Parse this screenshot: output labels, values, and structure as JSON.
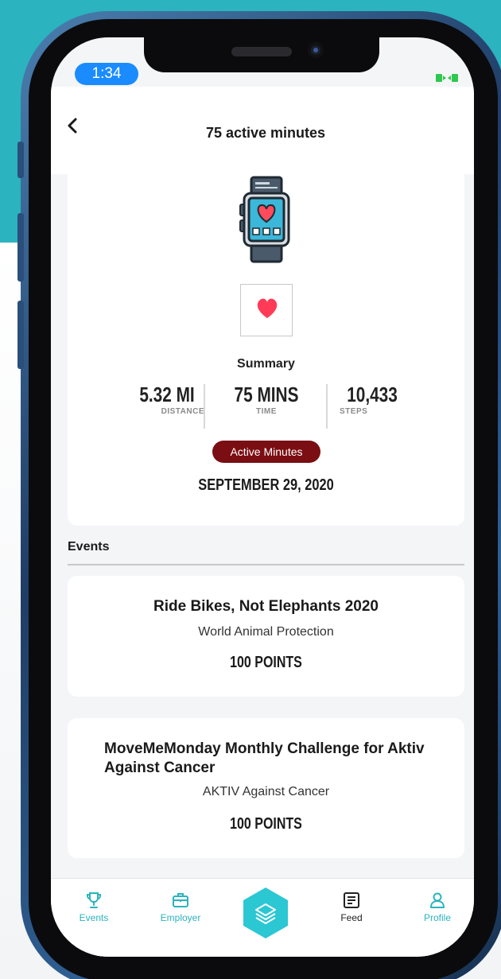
{
  "status": {
    "time": "1:34"
  },
  "header": {
    "title": "75 active minutes"
  },
  "summary": {
    "title": "Summary",
    "stats": [
      {
        "value": "5.32 MI",
        "label": "DISTANCE"
      },
      {
        "value": "75 MINS",
        "label": "TIME"
      },
      {
        "value": "10,433",
        "label": "STEPS"
      }
    ],
    "badge": "Active Minutes",
    "date": "SEPTEMBER 29, 2020"
  },
  "events": {
    "section_label": "Events",
    "items": [
      {
        "title": "Ride Bikes, Not Elephants 2020",
        "org": "World Animal Protection",
        "points": "100 POINTS"
      },
      {
        "title": "MoveMeMonday Monthly Challenge for Aktiv Against Cancer",
        "org": "AKTIV Against Cancer",
        "points": "100 POINTS"
      }
    ]
  },
  "tabbar": {
    "items": [
      {
        "label": "Events",
        "icon": "trophy-icon"
      },
      {
        "label": "Employer",
        "icon": "briefcase-icon"
      },
      {
        "label": "",
        "icon": "layers-icon"
      },
      {
        "label": "Feed",
        "icon": "feed-icon"
      },
      {
        "label": "Profile",
        "icon": "profile-icon"
      }
    ]
  },
  "colors": {
    "accent": "#2bb3bf",
    "badge": "#7a0e12",
    "status_time_bg": "#1a8cff",
    "heart": "#ff3b57"
  }
}
